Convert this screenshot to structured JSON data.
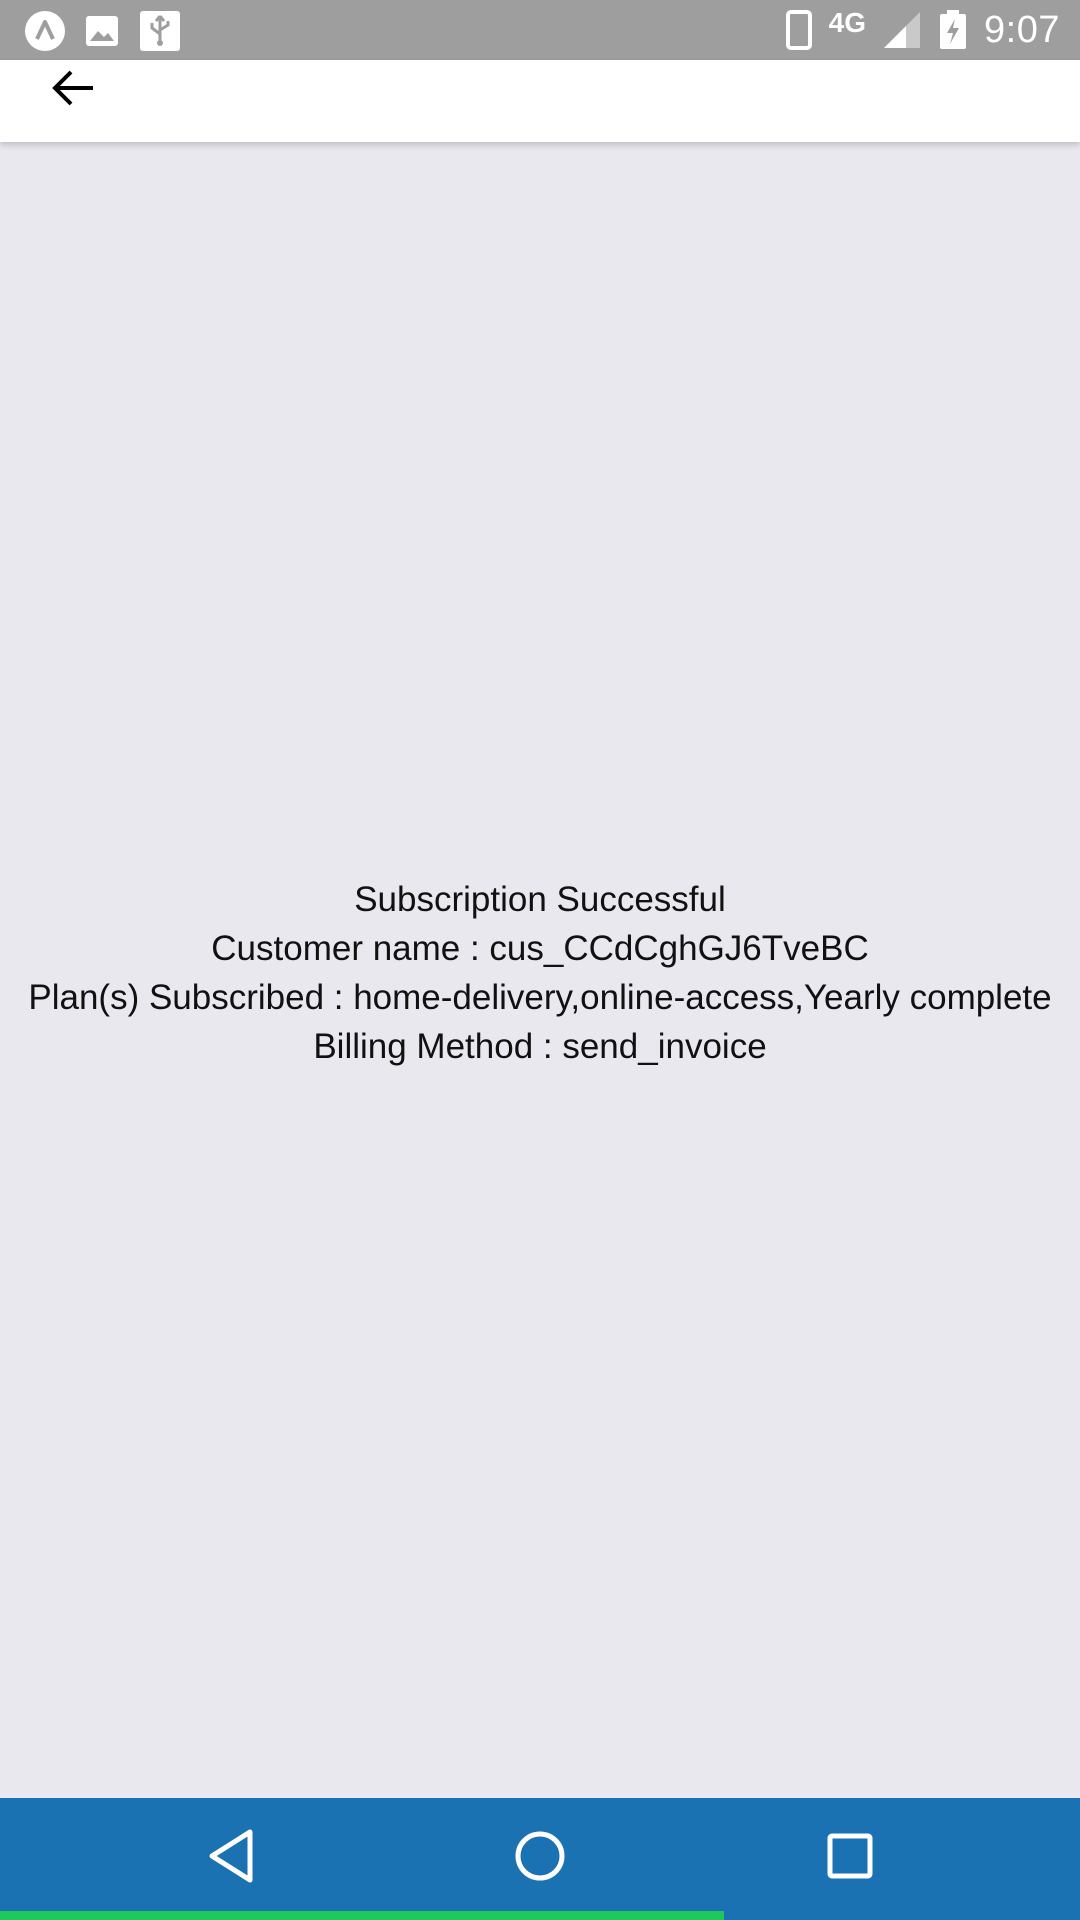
{
  "status_bar": {
    "time": "9:07",
    "network": "4G",
    "icons": [
      "app-notification-icon",
      "image-notification-icon",
      "usb-icon",
      "phone-icon",
      "signal-icon",
      "battery-charging-icon"
    ]
  },
  "app_bar": {
    "back_icon": "back-arrow-icon"
  },
  "content": {
    "title": "Subscription Successful",
    "customer_line": "Customer name : cus_CCdCghGJ6TveBC",
    "plans_line": "Plan(s) Subscribed : home-delivery,online-access,Yearly complete",
    "billing_line": "Billing Method : send_invoice"
  },
  "nav_bar": {
    "buttons": [
      "back-triangle-icon",
      "home-circle-icon",
      "recents-square-icon"
    ],
    "progress_fraction": 0.67
  },
  "colors": {
    "status_bar": "#9e9e9e",
    "app_bar": "#ffffff",
    "background": "#e9e8ef",
    "nav_bar": "#1b72b3",
    "progress": "#1ec85a"
  }
}
